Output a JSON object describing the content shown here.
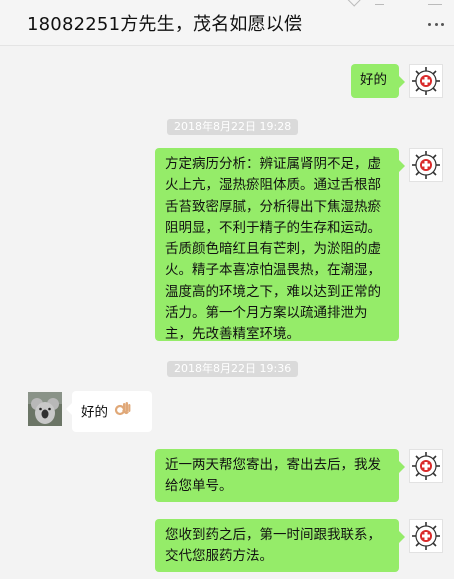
{
  "chat": {
    "title": "18082251方先生，茂名如愿以偿"
  },
  "icons": {
    "more": "more-dots-icon",
    "my_avatar": "red-emblem-logo-icon",
    "contact_avatar": "koala-photo-icon",
    "ok_hand": "ok-hand-emoji"
  },
  "colors": {
    "outgoing_bubble": "#95ec69",
    "incoming_bubble": "#ffffff",
    "background": "#f3f3f3",
    "timestamp_bg": "#dadada"
  },
  "messages": [
    {
      "sender": "me",
      "text": "好的"
    },
    {
      "type": "timestamp",
      "text": "2018年8月22日 19:28"
    },
    {
      "sender": "me",
      "text": "方定病历分析：辨证属肾阴不足，虚火上亢，湿热瘀阻体质。通过舌根部舌苔致密厚腻，分析得出下焦湿热瘀阻明显，不利于精子的生存和运动。舌质颜色暗红且有芒刺，为淤阻的虚火。精子本喜凉怕温畏热，在潮湿，温度高的环境之下，难以达到正常的活力。第一个月方案以疏通排泄为主，先改善精室环境。"
    },
    {
      "type": "timestamp",
      "text": "2018年8月22日 19:36"
    },
    {
      "sender": "contact",
      "text": "好的"
    },
    {
      "sender": "me",
      "text": "近一两天帮您寄出，寄出去后，我发给您单号。"
    },
    {
      "sender": "me",
      "text": "您收到药之后，第一时间跟我联系，交代您服药方法。"
    }
  ]
}
